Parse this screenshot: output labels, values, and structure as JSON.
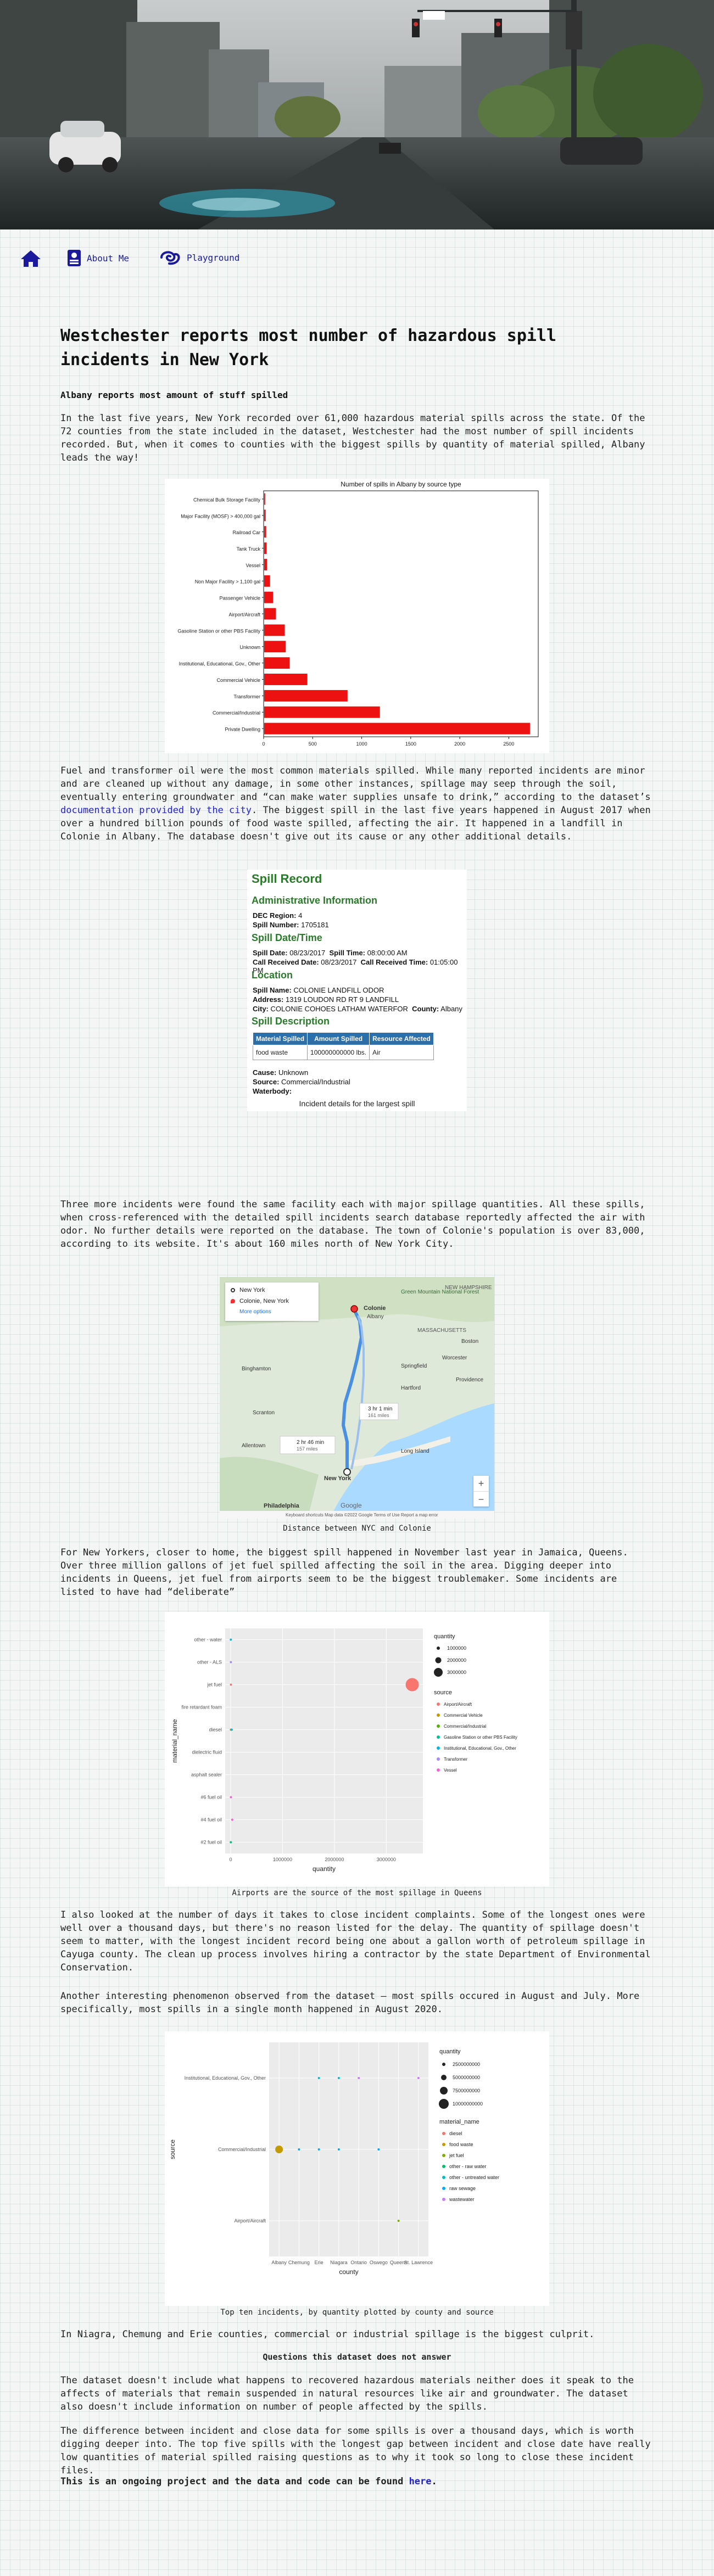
{
  "nav": {
    "home_icon": "home-icon",
    "about_label": "About Me",
    "about_icon": "person-card-icon",
    "playground_label": "Playground",
    "playground_icon": "swirl-icon"
  },
  "article": {
    "title": "Westchester reports most number of hazardous spill incidents in New York",
    "subhead": "Albany reports most amount of stuff spilled",
    "p1": "In the last five years, New York recorded over 61,000 hazardous material spills across the state. Of the 72 counties from the state included in the dataset, Westchester had the most number of spill incidents recorded. But, when it comes to counties with the biggest spills by quantity of material spilled, Albany leads the way!",
    "p2_a": "Fuel and transformer oil were the most common materials spilled. While many reported incidents are minor and are cleaned up without any damage, in some other instances, spillage may seep through the soil, eventually entering groundwater and “can make water supplies unsafe to drink,” according to the dataset’s ",
    "p2_link": "documentation provided by the city",
    "p2_b": ". The biggest spill in the last five years happened in August 2017 when over a hundred billion pounds of food waste spilled, affecting the air. It happened in a landfill in Colonie in Albany. The database doesn't give out its cause or any other additional details.",
    "caption_record": "Incident details for the largest spill",
    "p3": "Three more incidents were found the same facility each with major spillage quantities. All these spills, when cross-referenced with the detailed spill incidents search database reportedly affected the air with odor. No further details were reported on the database. The town of Colonie's population is over 83,000, according to its website. It's about 160 miles north of New York City.",
    "caption_map": "Distance between NYC and Colonie",
    "p4": "For New Yorkers, closer to home, the biggest spill happened in November last year in Jamaica, Queens. Over three million gallons of jet fuel spilled affecting the soil in the area. Digging deeper into incidents in Queens, jet fuel from airports seem to be the biggest troublemaker. Some incidents are listed to have had “deliberate”",
    "caption_queens": "Airports are the source of the most spillage in Queens",
    "p5": "I also looked at the number of days it takes to close incident complaints. Some of the longest ones were well over a thousand days, but there's no reason listed for the delay. The quantity of spillage doesn't seem to matter, with the longest incident record being one about a gallon worth of petroleum spillage in Cayuga county. The clean up process involves hiring a contractor by the state Department of Environmental Conservation.",
    "p6": "Another interesting phenomenon observed from the dataset — most spills occured in August and July. More specifically, most spills in a single month happened in August 2020.",
    "caption_counties": "Top ten incidents, by quantity plotted by county and source",
    "p7": "In Niagra, Chemung and Erie counties, commercial or industrial spillage is the biggest culprit.",
    "q_heading": "Questions this dataset does not answer",
    "p8": "The dataset doesn't include what happens to recovered hazardous materials neither does it speak to the affects of materials that remain suspended in natural resources like air and groundwater. The dataset also doesn't include information on number of people affected by the spills.",
    "p9": "The difference between incident and close data for some spills is over a thousand days, which is worth digging deeper into. The top five spills with the longest gap between incident and close date have really low quantities of material spilled raising questions as to why it took so long to close these incident files.",
    "p10_a": "This is an ongoing project and the data and code can be found ",
    "p10_link": "here",
    "p10_b": "."
  },
  "spill_record": {
    "title": "Spill Record",
    "admin_heading": "Administrative Information",
    "dec_region_label": "DEC Region:",
    "dec_region": "4",
    "spill_number_label": "Spill Number:",
    "spill_number": "1705181",
    "date_heading": "Spill Date/Time",
    "spill_date_label": "Spill Date:",
    "spill_date": "08/23/2017",
    "spill_time_label": "Spill Time:",
    "spill_time": "08:00:00 AM",
    "call_date_label": "Call Received Date:",
    "call_date": "08/23/2017",
    "call_time_label": "Call Received Time:",
    "call_time": "01:05:00 PM",
    "location_heading": "Location",
    "spill_name_label": "Spill Name:",
    "spill_name": "COLONIE LANDFILL ODOR",
    "address_label": "Address:",
    "address": "1319 LOUDON RD RT 9 LANDFILL",
    "city_label": "City:",
    "city": "COLONIE COHOES LATHAM WATERFOR",
    "county_label": "County:",
    "county": "Albany",
    "desc_heading": "Spill Description",
    "table_headers": [
      "Material Spilled",
      "Amount Spilled",
      "Resource Affected"
    ],
    "table_row": [
      "food waste",
      "100000000000 lbs.",
      "Air"
    ],
    "cause_label": "Cause:",
    "cause": "Unknown",
    "source_label": "Source:",
    "source": "Commercial/Industrial",
    "waterbody_label": "Waterbody:",
    "waterbody": ""
  },
  "map": {
    "origin": "New York",
    "destination": "Colonie, New York",
    "more_options": "More options",
    "route1_time": "2 hr 46 min",
    "route1_dist": "157 miles",
    "route2_time": "3 hr 1 min",
    "route2_dist": "161 miles",
    "labels": [
      "Colonie",
      "Albany",
      "Green Mountain National Forest",
      "NEW HAMPSHIRE",
      "MASSACHUSETTS",
      "Worcester",
      "Springfield",
      "Boston",
      "Providence",
      "Hartford",
      "Binghamton",
      "Scranton",
      "Allentown",
      "Long Island",
      "New York",
      "Philadelphia"
    ],
    "footer": "Keyboard shortcuts   Map data ©2022 Google   Terms of Use   Report a map error",
    "google": "Google",
    "zoom_in": "+",
    "zoom_out": "−"
  },
  "colors": {
    "bar": "#ee1111",
    "spill_green": "#2b7a2b",
    "link": "#2222cc",
    "nav": "#1a1a9a",
    "route": "#4a90e2"
  },
  "chart_data": [
    {
      "type": "bar",
      "orientation": "horizontal",
      "title": "Number of spills in Albany by source type",
      "categories": [
        "Chemical Bulk Storage Facility",
        "Major Facility (MOSF) > 400,000 gal",
        "Railroad Car",
        "Tank Truck",
        "Vessel",
        "Non Major Facility > 1,100 gal",
        "Passenger Vehicle",
        "Airport/Aircraft",
        "Gasoline Station or other PBS Facility",
        "Unknown",
        "Institutional, Educational, Gov., Other",
        "Commercial Vehicle",
        "Transformer",
        "Commercial/Industrial",
        "Private Dwelling"
      ],
      "values": [
        10,
        15,
        20,
        25,
        30,
        60,
        90,
        120,
        210,
        220,
        260,
        440,
        850,
        1180,
        2710
      ],
      "xticks": [
        0,
        500,
        1000,
        1500,
        2000,
        2500
      ],
      "xlim": [
        0,
        2800
      ]
    },
    {
      "type": "scatter",
      "title": "",
      "xlabel": "quantity",
      "ylabel": "material_name",
      "categories": [
        "#2 fuel oil",
        "#4 fuel oil",
        "#6 fuel oil",
        "asphalt sealer",
        "dielectric fluid",
        "diesel",
        "fire retardant foam",
        "jet fuel",
        "other - ALS",
        "other - water"
      ],
      "xticks": [
        0,
        1000000,
        2000000,
        3000000
      ],
      "xtick_labels": [
        "0",
        "1000000",
        "2000000",
        "3000000"
      ],
      "xlim": [
        0,
        3600000
      ],
      "size_legend_title": "quantity",
      "size_legend": [
        "1000000",
        "2000000",
        "3000000"
      ],
      "color_legend_title": "source",
      "series": [
        {
          "name": "Airport/Aircraft",
          "color": "#f8766d",
          "points": [
            {
              "x": 3500000,
              "y": "jet fuel"
            },
            {
              "x": 5000,
              "y": "jet fuel"
            }
          ]
        },
        {
          "name": "Commercial Vehicle",
          "color": "#c49a00",
          "points": [
            {
              "x": 4000,
              "y": "diesel"
            }
          ]
        },
        {
          "name": "Commercial/Industrial",
          "color": "#53b400",
          "points": [
            {
              "x": 3000,
              "y": "#2 fuel oil"
            }
          ]
        },
        {
          "name": "Gasoline Station or other PBS Facility",
          "color": "#00c094",
          "points": [
            {
              "x": 3000,
              "y": "#2 fuel oil"
            }
          ]
        },
        {
          "name": "Institutional, Educational, Gov., Other",
          "color": "#00b6eb",
          "points": [
            {
              "x": 20000,
              "y": "diesel"
            },
            {
              "x": 3000,
              "y": "other - water"
            }
          ]
        },
        {
          "name": "Transformer",
          "color": "#a58aff",
          "points": [
            {
              "x": 4000,
              "y": "other - ALS"
            }
          ]
        },
        {
          "name": "Vessel",
          "color": "#fb61d7",
          "points": [
            {
              "x": 30000,
              "y": "#4 fuel oil"
            },
            {
              "x": 5000,
              "y": "#6 fuel oil"
            }
          ]
        }
      ]
    },
    {
      "type": "scatter",
      "title": "",
      "xlabel": "county",
      "ylabel": "source",
      "x": [
        "Albany",
        "Chemung",
        "Erie",
        "Niagara",
        "Ontario",
        "Oswego",
        "Queens",
        "St. Lawrence"
      ],
      "y": [
        "Airport/Aircraft",
        "Commercial/Industrial",
        "Institutional, Educational, Gov., Other"
      ],
      "size_legend_title": "quantity",
      "size_legend": [
        "2500000000",
        "5000000000",
        "7500000000",
        "10000000000"
      ],
      "color_legend_title": "material_name",
      "series": [
        {
          "name": "diesel",
          "color": "#f8766d",
          "points": []
        },
        {
          "name": "food waste",
          "color": "#c49a00",
          "points": [
            {
              "x": "Albany",
              "y": "Commercial/Industrial",
              "size": "large"
            }
          ]
        },
        {
          "name": "jet fuel",
          "color": "#7cae00",
          "points": [
            {
              "x": "Queens",
              "y": "Airport/Aircraft"
            }
          ]
        },
        {
          "name": "other - raw water",
          "color": "#00be67",
          "points": []
        },
        {
          "name": "other - untreated water",
          "color": "#00bfc4",
          "points": [
            {
              "x": "Erie",
              "y": "Institutional, Educational, Gov., Other"
            },
            {
              "x": "Niagara",
              "y": "Institutional, Educational, Gov., Other"
            }
          ]
        },
        {
          "name": "raw sewage",
          "color": "#00a9ff",
          "points": [
            {
              "x": "Chemung",
              "y": "Commercial/Industrial"
            },
            {
              "x": "Erie",
              "y": "Commercial/Industrial"
            },
            {
              "x": "Niagara",
              "y": "Commercial/Industrial"
            },
            {
              "x": "Oswego",
              "y": "Commercial/Industrial"
            }
          ]
        },
        {
          "name": "wastewater",
          "color": "#c77cff",
          "points": [
            {
              "x": "St. Lawrence",
              "y": "Institutional, Educational, Gov., Other"
            },
            {
              "x": "Ontario",
              "y": "Institutional, Educational, Gov., Other"
            }
          ]
        }
      ]
    }
  ]
}
